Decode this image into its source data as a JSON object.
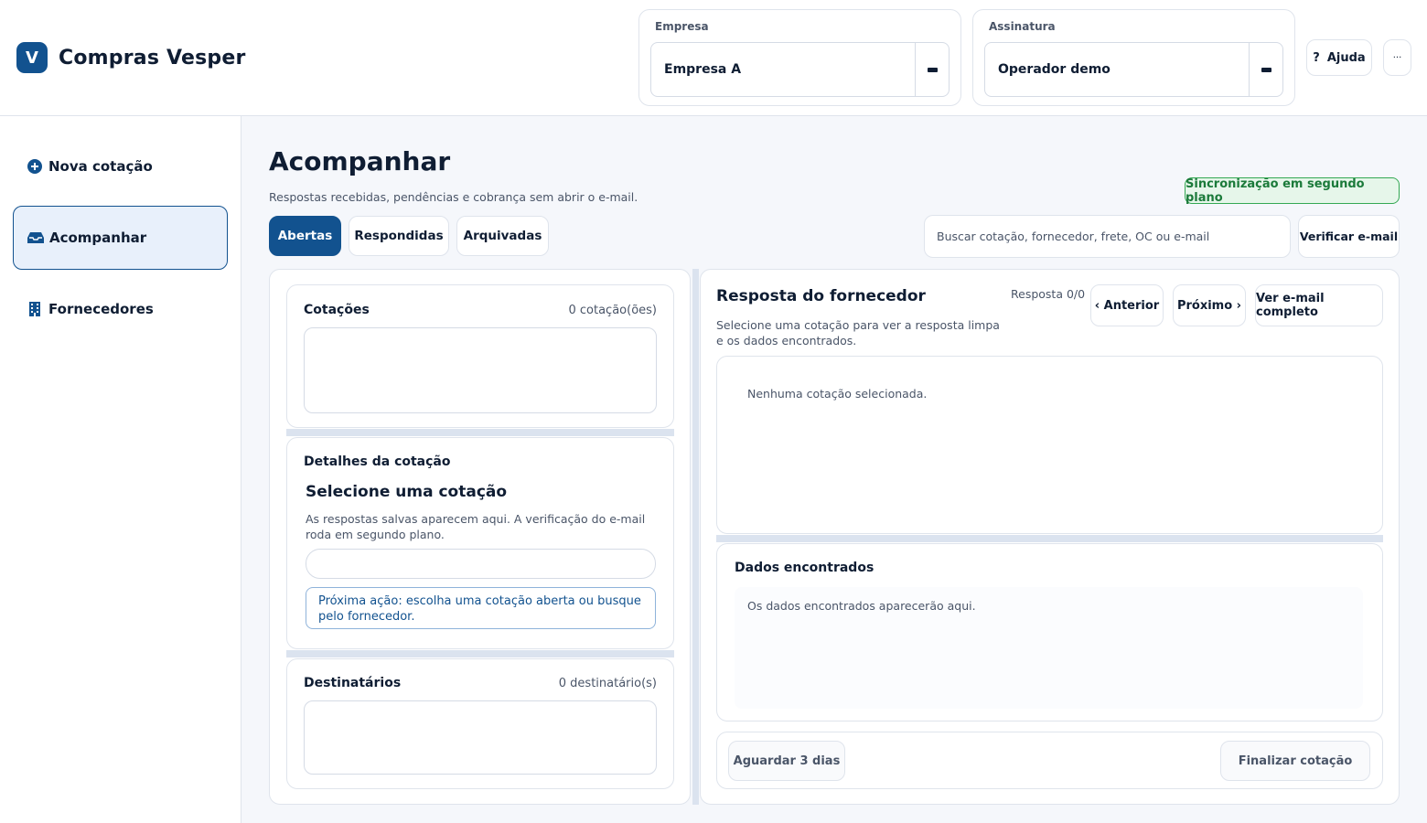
{
  "app": {
    "logo_letter": "V",
    "name": "Compras Vesper"
  },
  "header": {
    "empresa": {
      "label": "Empresa",
      "value": "Empresa A"
    },
    "assinatura": {
      "label": "Assinatura",
      "value": "Operador demo"
    },
    "help": {
      "icon": "?",
      "label": "Ajuda"
    },
    "more": {
      "label": "···"
    }
  },
  "sidebar": {
    "items": [
      {
        "label": "Nova cotação",
        "icon": "plus-circle-icon"
      },
      {
        "label": "Acompanhar",
        "icon": "inbox-icon",
        "active": true
      },
      {
        "label": "Fornecedores",
        "icon": "building-icon"
      }
    ]
  },
  "main": {
    "title": "Acompanhar",
    "subtitle": "Respostas recebidas, pendências e cobrança sem abrir o e-mail.",
    "sync_badge": "Sincronização em segundo plano",
    "tabs": [
      {
        "label": "Abertas",
        "active": true
      },
      {
        "label": "Respondidas"
      },
      {
        "label": "Arquivadas"
      }
    ],
    "search": {
      "placeholder": "Buscar cotação, fornecedor, frete, OC ou e-mail",
      "value": ""
    },
    "verify_button": "Verificar e-mail"
  },
  "left": {
    "quotes": {
      "title": "Cotações",
      "count": "0 cotação(ões)"
    },
    "details": {
      "title": "Detalhes da cotação",
      "heading": "Selecione uma cotação",
      "description": "As respostas salvas aparecem aqui. A verificação do e-mail roda em segundo plano.",
      "next_action": "Próxima ação: escolha uma cotação aberta ou busque pelo fornecedor."
    },
    "recipients": {
      "title": "Destinatários",
      "count": "0 destinatário(s)"
    }
  },
  "right": {
    "title": "Resposta do fornecedor",
    "subtitle": "Selecione uma cotação para ver a resposta limpa e os dados encontrados.",
    "counter": "Resposta 0/0",
    "prev_button": "‹ Anterior",
    "next_button": "Próximo ›",
    "full_email_button": "Ver e-mail completo",
    "empty_message": "Nenhuma cotação selecionada.",
    "found": {
      "title": "Dados encontrados",
      "placeholder": "Os dados encontrados aparecerão aqui."
    },
    "wait_button": "Aguardar 3 dias",
    "finish_button": "Finalizar cotação"
  },
  "colors": {
    "primary": "#12528f",
    "success_bg": "#e6f6ea",
    "success_text": "#1b7a3a",
    "success_border": "#34a853"
  }
}
